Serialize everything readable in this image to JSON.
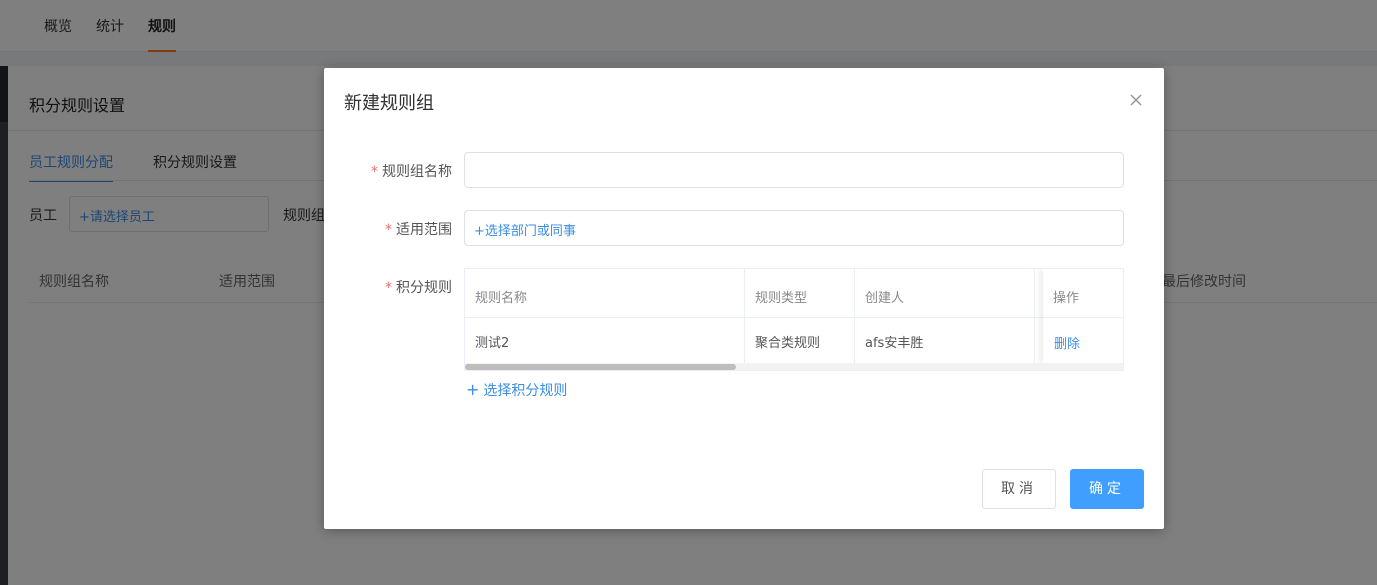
{
  "top_nav": {
    "tabs": [
      {
        "label": "概览"
      },
      {
        "label": "统计"
      },
      {
        "label": "规则"
      }
    ],
    "active_index": 2,
    "accent_color": "#ff7a22"
  },
  "page": {
    "title": "积分规则设置",
    "subtabs": [
      {
        "label": "员工规则分配"
      },
      {
        "label": "积分规则设置"
      }
    ],
    "active_subtab": 0,
    "filters": {
      "employee_label": "员工",
      "employee_placeholder": "+请选择员工",
      "rule_group_label": "规则组"
    },
    "table_headers": {
      "rule_group_name": "规则组名称",
      "scope": "适用范围",
      "last_modified": "最后修改时间"
    }
  },
  "dialog": {
    "title": "新建规则组",
    "close_icon": "close-icon",
    "fields": {
      "group_name": {
        "label": "规则组名称",
        "required": true,
        "value": "",
        "placeholder": ""
      },
      "scope": {
        "label": "适用范围",
        "required": true,
        "link_text": "+选择部门或同事"
      },
      "rules": {
        "label": "积分规则",
        "required": true
      }
    },
    "rules_table": {
      "columns": [
        "规则名称",
        "规则类型",
        "创建人",
        "操作"
      ],
      "rows": [
        {
          "name": "测试2",
          "type": "聚合类规则",
          "creator": "afs安丰胜",
          "action": "删除"
        }
      ],
      "horizontal_scroll_fraction": 0.41
    },
    "add_rule_label": "选择积分规则",
    "buttons": {
      "cancel": "取消",
      "ok": "确定"
    },
    "primary_color": "#409eff",
    "link_color": "#3a8ee6",
    "required_color": "#f56c6c"
  }
}
